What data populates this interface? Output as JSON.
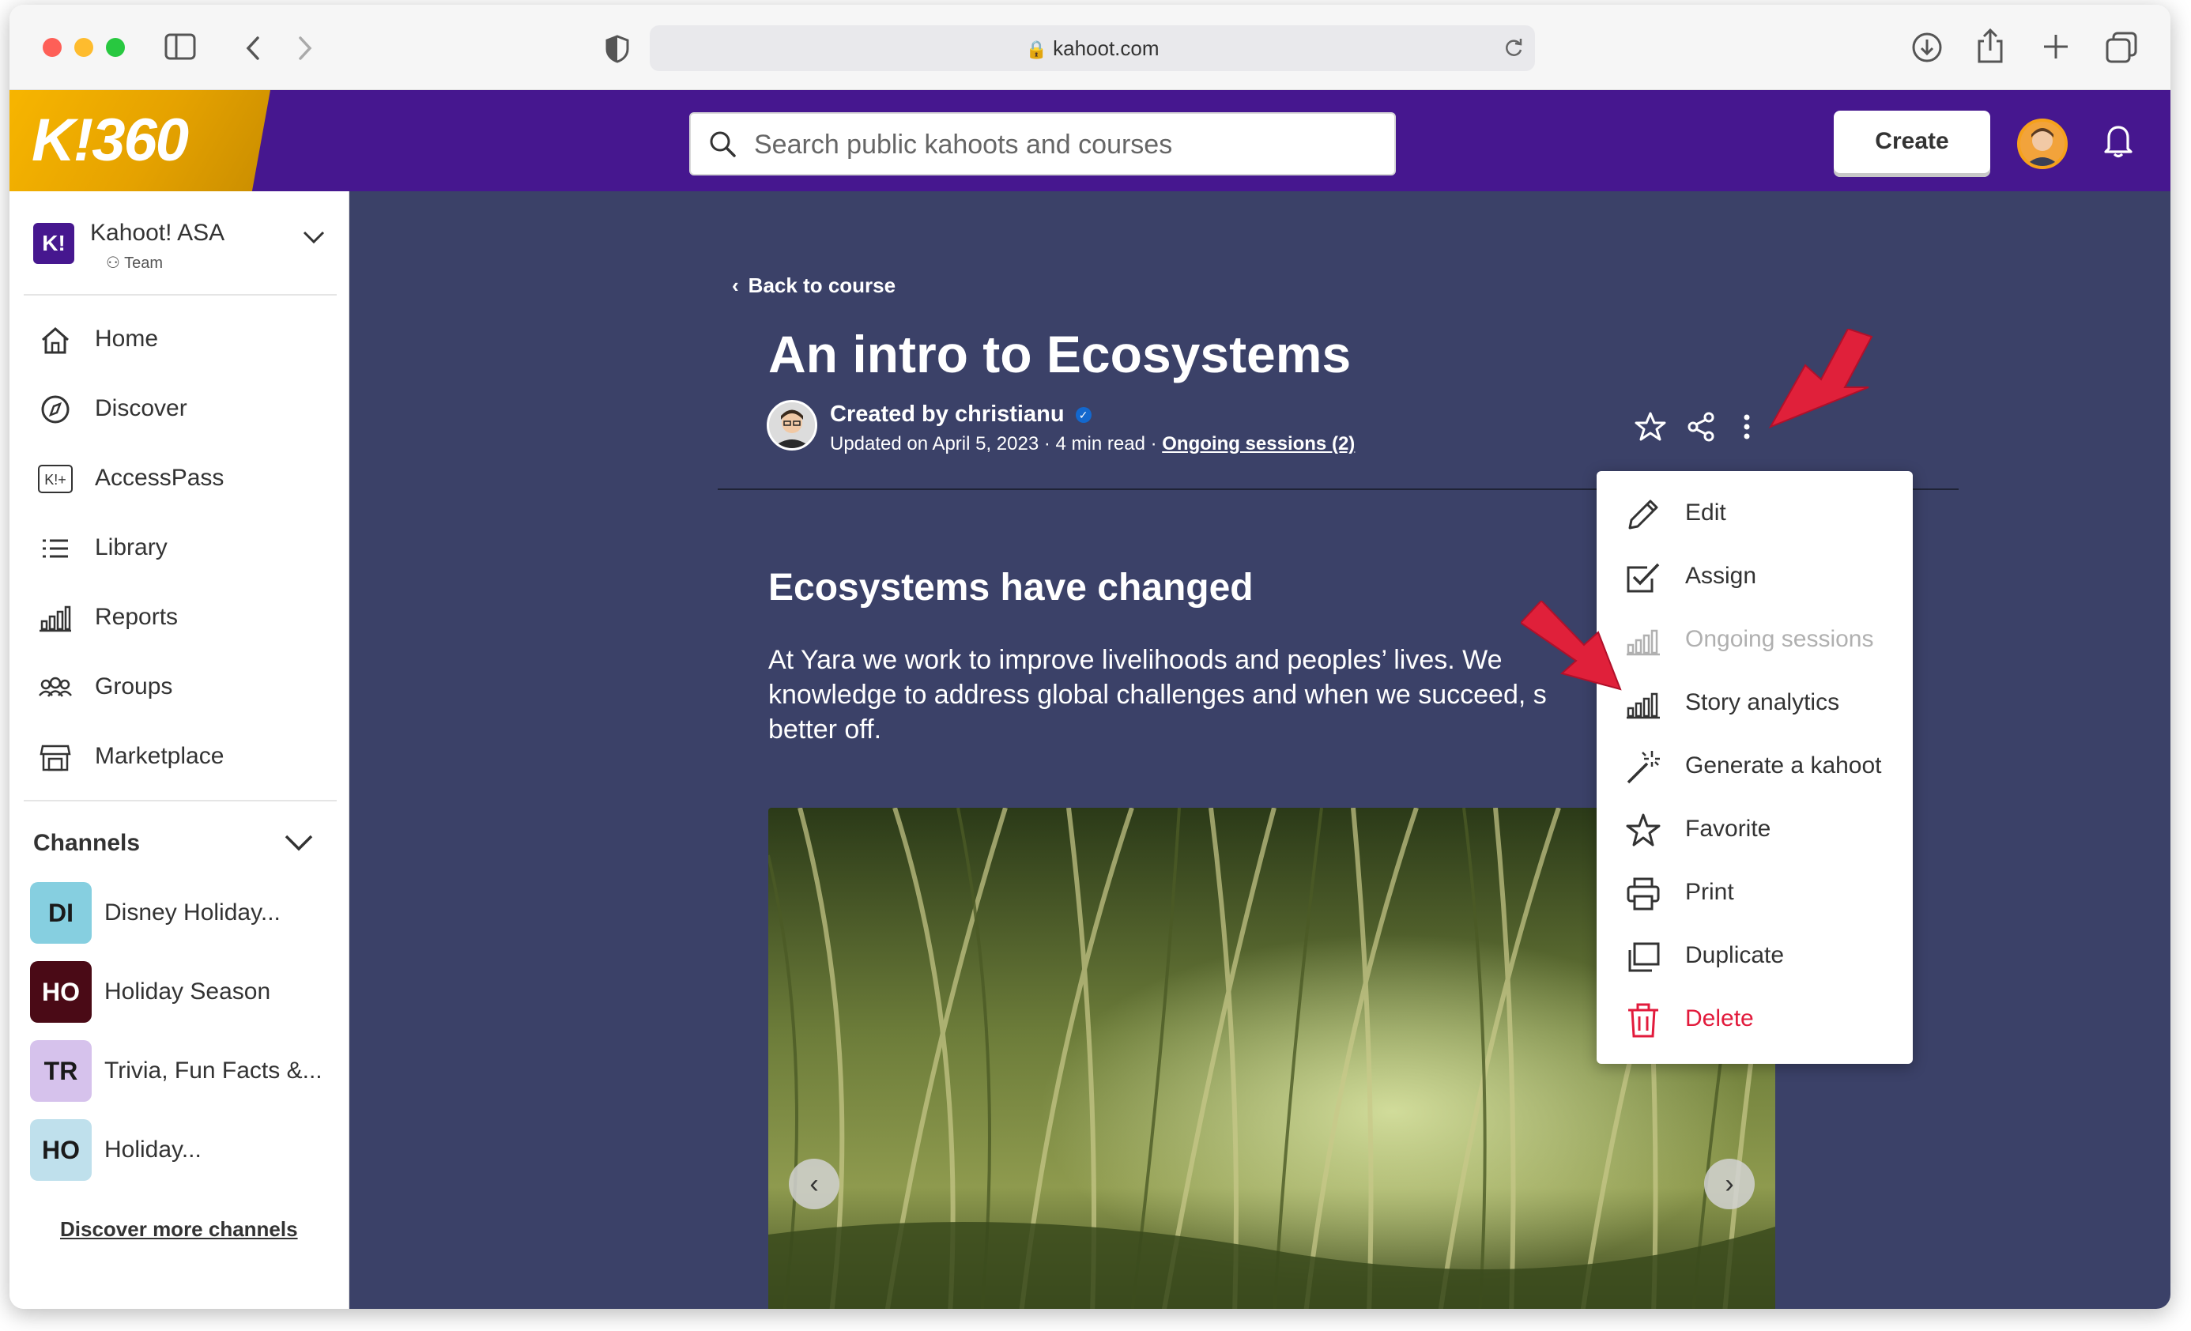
{
  "browser": {
    "url": "kahoot.com"
  },
  "header": {
    "logo_text": "K!360",
    "search_placeholder": "Search public kahoots and courses",
    "create_label": "Create"
  },
  "sidebar": {
    "org_name": "Kahoot! ASA",
    "org_type": "Team",
    "org_icon": "K!",
    "nav": [
      {
        "label": "Home",
        "icon": "home-icon"
      },
      {
        "label": "Discover",
        "icon": "compass-icon"
      },
      {
        "label": "AccessPass",
        "icon": "accesspass-icon"
      },
      {
        "label": "Library",
        "icon": "list-icon"
      },
      {
        "label": "Reports",
        "icon": "bar-chart-icon"
      },
      {
        "label": "Groups",
        "icon": "groups-icon"
      },
      {
        "label": "Marketplace",
        "icon": "store-icon"
      }
    ],
    "channels_heading": "Channels",
    "channels": [
      {
        "badge": "DI",
        "label": "Disney Holiday...",
        "bg": "#86cfe0",
        "fg": "#1a1a1a"
      },
      {
        "badge": "HO",
        "label": "Holiday Season",
        "bg": "#4a0a16",
        "fg": "#ffffff"
      },
      {
        "badge": "TR",
        "label": "Trivia, Fun Facts &...",
        "bg": "#d6c2ec",
        "fg": "#1a1a1a"
      },
      {
        "badge": "HO",
        "label": "Holiday...",
        "bg": "#bfe0ec",
        "fg": "#1a1a1a"
      }
    ],
    "discover_more": "Discover more channels"
  },
  "main": {
    "back_label": "Back to course",
    "title": "An intro to Ecosystems",
    "author_line": "Created by christianu",
    "updated_line": "Updated on April 5, 2023 · 4 min read ·",
    "ongoing_link": "Ongoing sessions (2)",
    "section_heading": "Ecosystems have changed",
    "paragraph_lines": [
      "At Yara we work to improve livelihoods and peoples’ lives. We",
      "knowledge to address global challenges and when we succeed, s",
      "better off."
    ]
  },
  "menu": {
    "items": [
      {
        "label": "Edit",
        "icon": "pencil-icon",
        "state": "normal"
      },
      {
        "label": "Assign",
        "icon": "checkbox-icon",
        "state": "normal"
      },
      {
        "label": "Ongoing sessions",
        "icon": "bar-chart-icon",
        "state": "disabled"
      },
      {
        "label": "Story analytics",
        "icon": "bar-chart-icon",
        "state": "normal"
      },
      {
        "label": "Generate a kahoot",
        "icon": "magic-wand-icon",
        "state": "normal"
      },
      {
        "label": "Favorite",
        "icon": "star-icon",
        "state": "normal"
      },
      {
        "label": "Print",
        "icon": "printer-icon",
        "state": "normal"
      },
      {
        "label": "Duplicate",
        "icon": "duplicate-icon",
        "state": "normal"
      },
      {
        "label": "Delete",
        "icon": "trash-icon",
        "state": "danger"
      }
    ]
  },
  "colors": {
    "brand_purple": "#46178f",
    "main_bg": "#3b4168",
    "danger": "#e21b3c",
    "disabled": "#b0b0b0",
    "annotation_arrow": "#e0203a"
  }
}
